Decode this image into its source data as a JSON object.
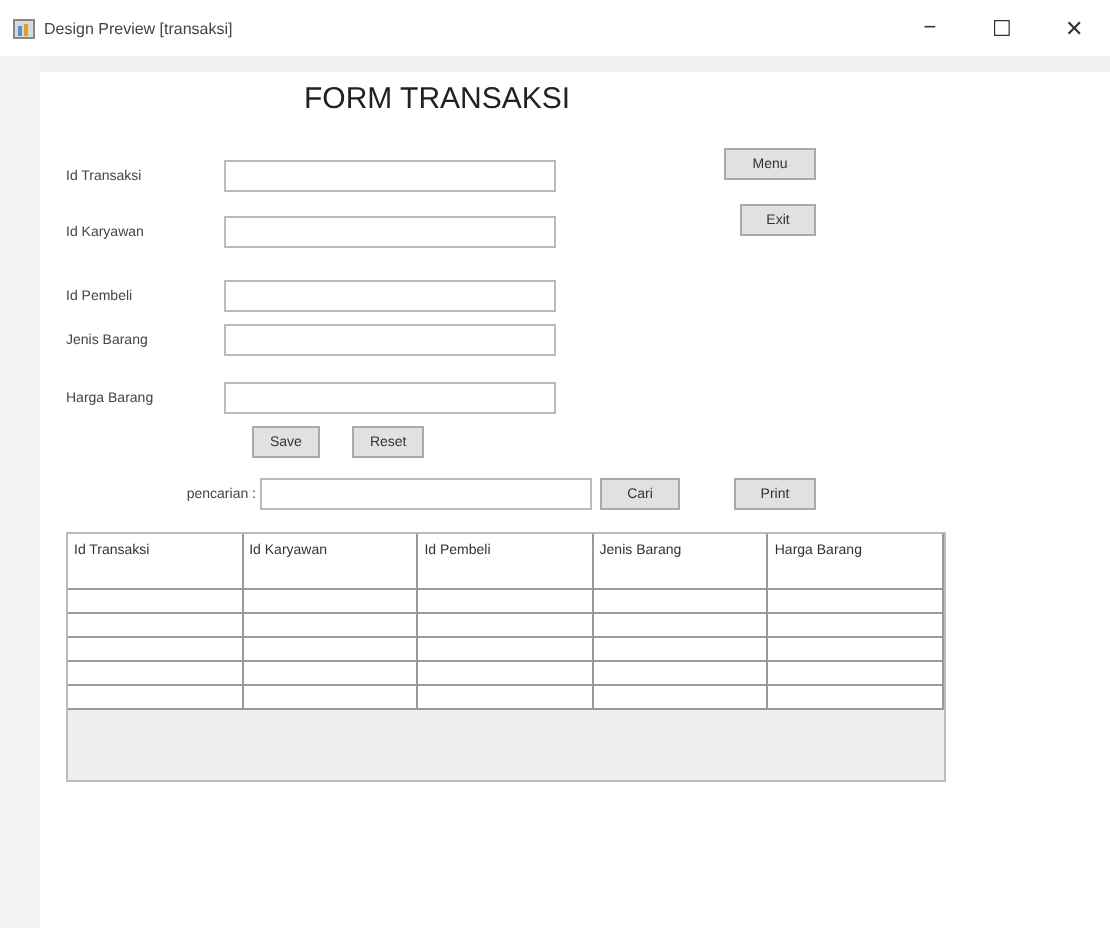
{
  "window": {
    "title": "Design Preview [transaksi]",
    "controls": [
      "−",
      "☐",
      "✕"
    ]
  },
  "heading": "FORM TRANSAKSI",
  "fields": [
    {
      "label": "Id Transaksi"
    },
    {
      "label": "Id Karyawan"
    },
    {
      "label": "Id Pembeli"
    },
    {
      "label": "Jenis Barang"
    },
    {
      "label": "Harga Barang"
    }
  ],
  "side_buttons": [
    "Menu",
    "Exit"
  ],
  "form_buttons": [
    "Save",
    "Reset"
  ],
  "search": {
    "label": "pencarian :",
    "buttons": [
      "Cari",
      "Print"
    ]
  },
  "table": {
    "columns": [
      "Id Transaksi",
      "Id Karyawan",
      "Id Pembeli",
      "Jenis Barang",
      "Harga Barang"
    ]
  }
}
